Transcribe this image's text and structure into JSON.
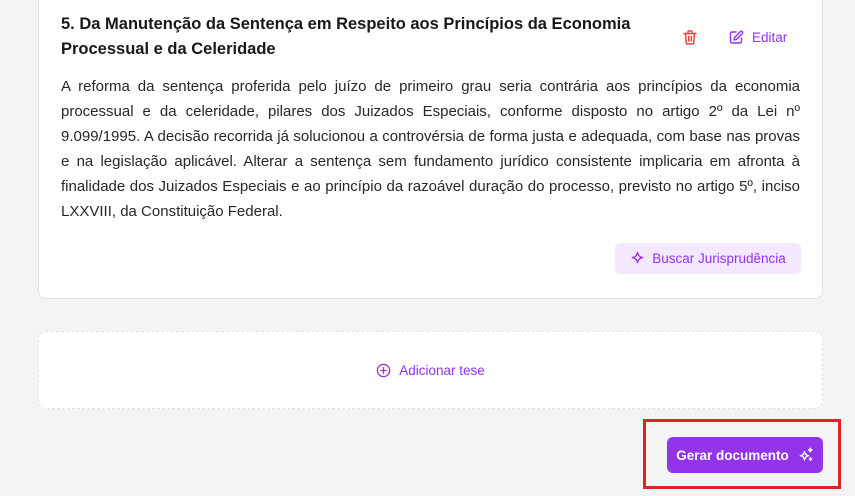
{
  "thesis_card": {
    "title": "5. Da Manutenção da Sentença em Respeito aos Princípios da Economia Processual e da Celeridade",
    "body": "A reforma da sentença proferida pelo juízo de primeiro grau seria contrária aos princípios da economia processual e da celeridade, pilares dos Juizados Especiais, conforme disposto no artigo 2º da Lei nº 9.099/1995. A decisão recorrida já solucionou a controvérsia de forma justa e adequada, com base nas provas e na legislação aplicável. Alterar a sentença sem fundamento jurídico consistente implicaria em afronta à finalidade dos Juizados Especiais e ao princípio da razoável duração do processo, previsto no artigo 5º, inciso LXXVIII, da Constituição Federal.",
    "edit_label": "Editar",
    "search_label": "Buscar Jurisprudência",
    "delete_icon": "trash-icon",
    "edit_icon": "pencil-square-icon",
    "search_icon": "sparkle-icon"
  },
  "add_thesis": {
    "label": "Adicionar tese",
    "icon": "plus-circle-icon"
  },
  "generate": {
    "label": "Gerar documento",
    "icon": "sparkles-icon"
  },
  "colors": {
    "accent": "#9333ea",
    "accent_soft": "#f3e8ff",
    "danger": "#dc2626",
    "background": "#f4f4f5"
  }
}
